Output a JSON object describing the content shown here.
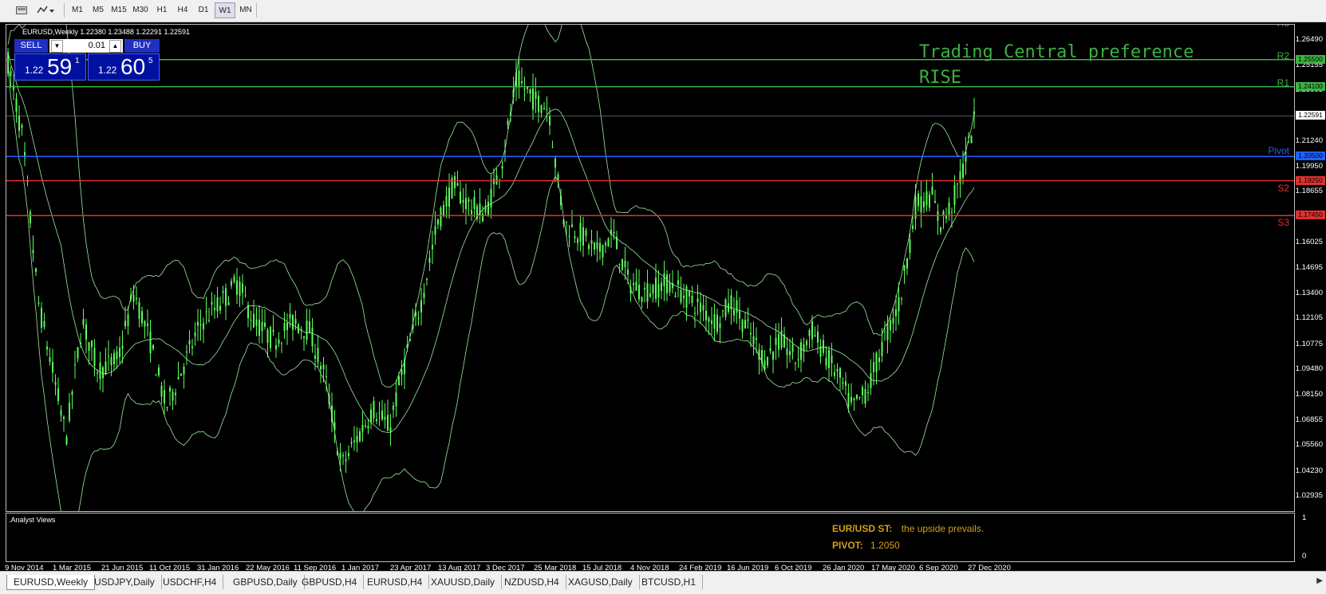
{
  "toolbar": {
    "timeframes": [
      "M1",
      "M5",
      "M15",
      "M30",
      "H1",
      "H4",
      "D1",
      "W1",
      "MN"
    ],
    "active_timeframe": "W1",
    "icons": [
      "chart-window-icon",
      "indicators-icon"
    ]
  },
  "chart": {
    "info_line": "EURUSD,Weekly  1.22380 1.23488 1.22291 1.22591",
    "one_click": {
      "sell_label": "SELL",
      "buy_label": "BUY",
      "lot": "0.01",
      "sell_price_small": "1.22",
      "sell_price_big": "59",
      "sell_price_sup": "1",
      "buy_price_small": "1.22",
      "buy_price_big": "60",
      "buy_price_sup": "5"
    },
    "overlay_title": "Trading Central preference",
    "overlay_subtitle": "RISE",
    "levels": [
      {
        "name": "R3",
        "value": "",
        "color": "#3cb043"
      },
      {
        "name": "R2",
        "value": "1.25500",
        "color": "#3cb043"
      },
      {
        "name": "R1",
        "value": "1.24100",
        "color": "#3cb043"
      },
      {
        "name": "Pivot",
        "value": "1.20500",
        "color": "#2060ff"
      },
      {
        "name": "S2",
        "value": "1.19250",
        "color": "#e03030"
      },
      {
        "name": "S3",
        "value": "1.17450",
        "color": "#e03030"
      }
    ],
    "current_price": "1.22591",
    "y_ticks": [
      "1.26490",
      "1.25155",
      "1.23865",
      "1.22591",
      "1.21240",
      "1.19950",
      "1.18655",
      "1.17375",
      "1.16025",
      "1.14695",
      "1.13400",
      "1.12105",
      "1.10775",
      "1.09480",
      "1.08150",
      "1.06855",
      "1.05560",
      "1.04230",
      "1.02935"
    ],
    "x_ticks": [
      "9 Nov 2014",
      "1 Mar 2015",
      "21 Jun 2015",
      "11 Oct 2015",
      "31 Jan 2016",
      "22 May 2016",
      "11 Sep 2016",
      "1 Jan 2017",
      "23 Apr 2017",
      "13 Aug 2017",
      "3 Dec 2017",
      "25 Mar 2018",
      "15 Jul 2018",
      "4 Nov 2018",
      "24 Feb 2019",
      "16 Jun 2019",
      "6 Oct 2019",
      "26 Jan 2020",
      "17 May 2020",
      "6 Sep 2020",
      "27 Dec 2020"
    ],
    "colors": {
      "candles": "#5aff5a",
      "bands": "#9fe89f",
      "background": "#000000",
      "r_lines": "#3cb043",
      "pivot": "#2060ff",
      "s_lines": "#e03030"
    }
  },
  "analyst": {
    "panel_label": ".Analyst Views",
    "pair_label": "EUR/USD ST:",
    "view_text": "the upside prevails.",
    "pivot_label": "PIVOT:",
    "pivot_value": "1.2050",
    "scale_top": "1",
    "scale_bottom": "0"
  },
  "tabs": [
    {
      "label": "EURUSD,Weekly",
      "active": true
    },
    {
      "label": "USDJPY,Daily",
      "active": false
    },
    {
      "label": "USDCHF,H4",
      "active": false
    },
    {
      "label": "GBPUSD,Daily",
      "active": false
    },
    {
      "label": "GBPUSD,H4",
      "active": false
    },
    {
      "label": "EURUSD,H4",
      "active": false
    },
    {
      "label": "XAUUSD,Daily",
      "active": false
    },
    {
      "label": "NZDUSD,H4",
      "active": false
    },
    {
      "label": "XAGUSD,Daily",
      "active": false
    },
    {
      "label": "BTCUSD,H1",
      "active": false
    }
  ]
}
